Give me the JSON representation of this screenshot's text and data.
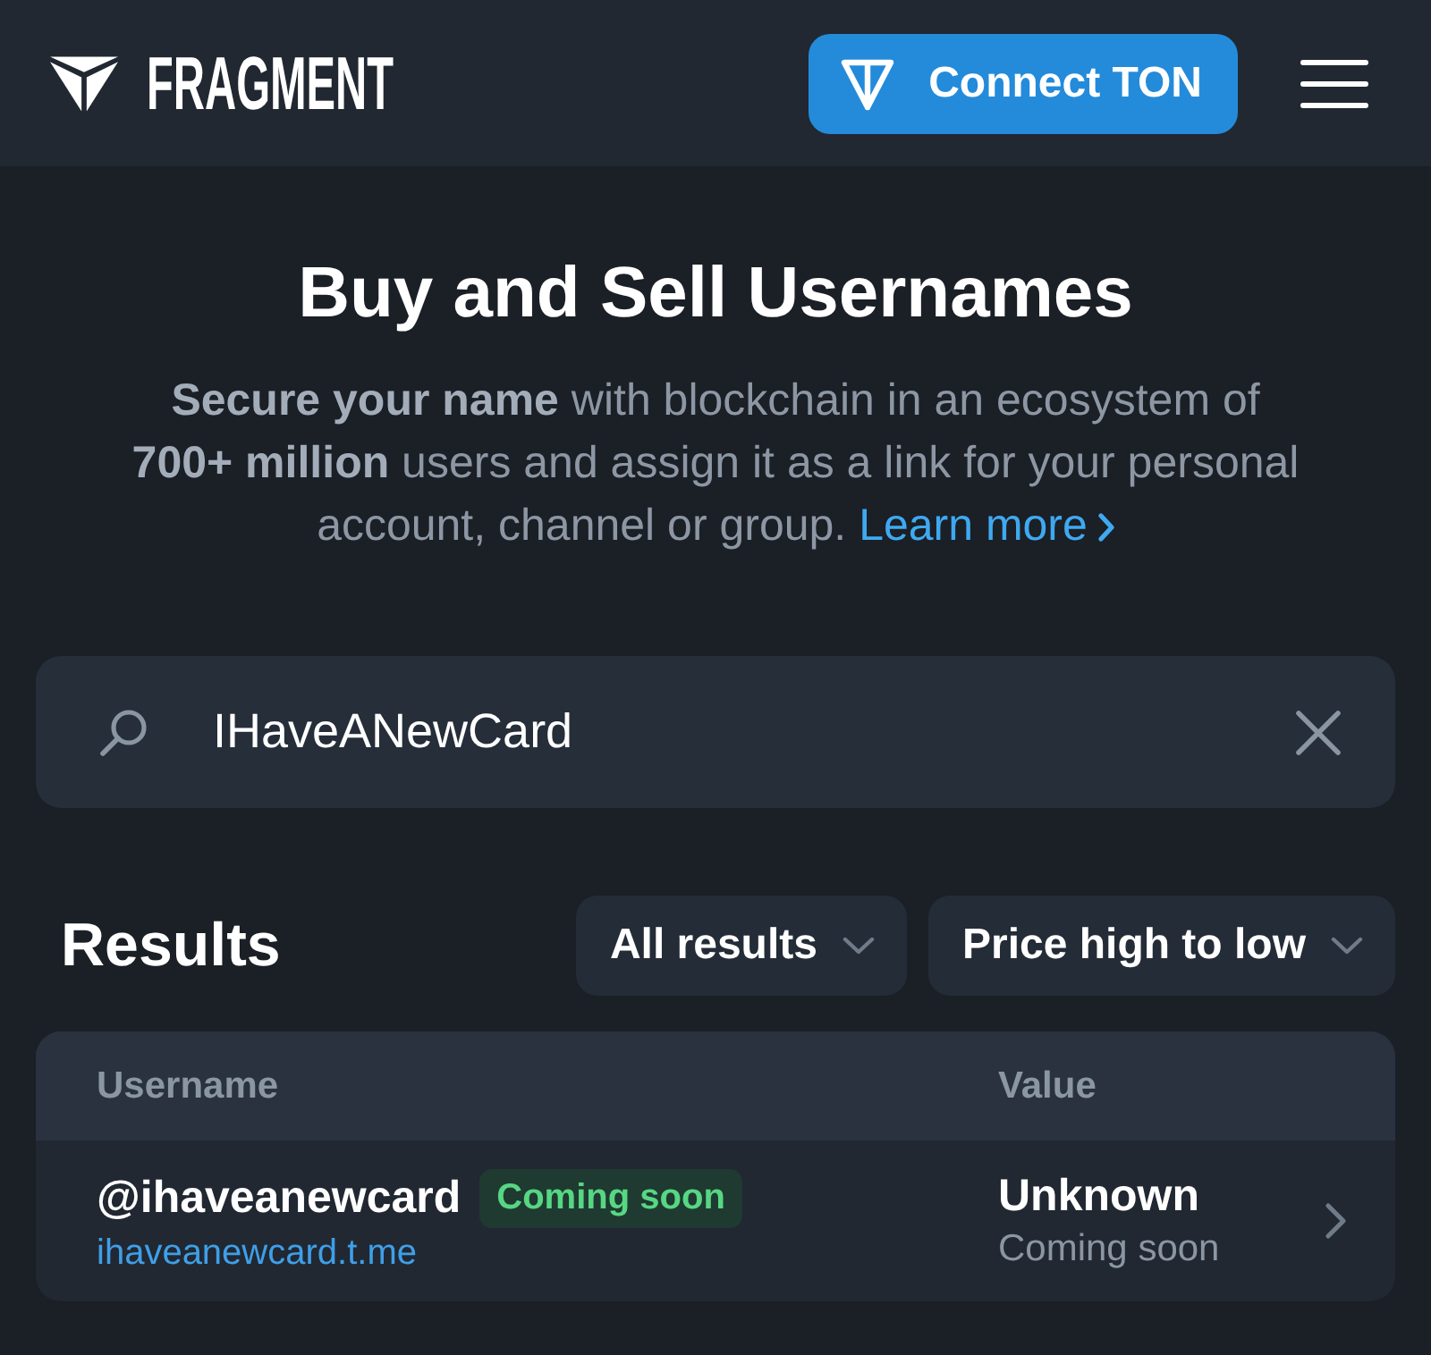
{
  "header": {
    "logo": "FRAGMENT",
    "connect_button": "Connect TON"
  },
  "hero": {
    "title": "Buy and Sell Usernames",
    "description": "**Secure your name** with blockchain in an ecosystem of **700+ million** users and assign it as a link for your personal account, channel or group.",
    "link": "Learn more"
  },
  "search": {
    "value": "IHaveANewCard"
  },
  "results": {
    "title": "Results",
    "filters": [
      {
        "label": "All results"
      },
      {
        "label": "Price high to low"
      }
    ],
    "table": {
      "columns": [
        "Username",
        "Value"
      ],
      "rows": [
        {
          "username": "@ihaveanewcard",
          "badge": "Coming soon",
          "link": "ihaveanewcard.t.me",
          "value": "Unknown",
          "value_note": "Coming soon"
        }
      ]
    }
  }
}
